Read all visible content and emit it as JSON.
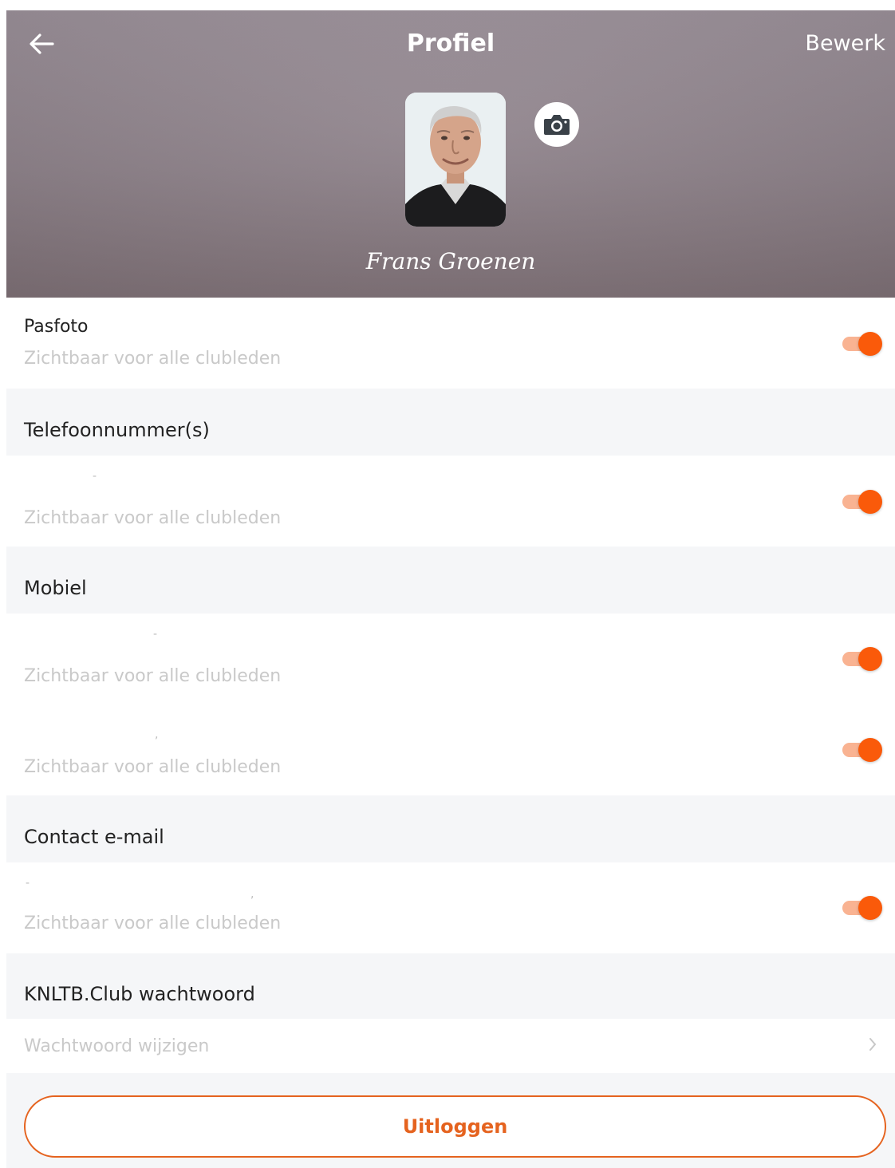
{
  "header": {
    "title": "Profiel",
    "edit_label": "Bewerk",
    "user_name": "Frans Groenen"
  },
  "rows": {
    "pasfoto": {
      "label": "Pasfoto",
      "visibility": "Zichtbaar voor alle clubleden",
      "enabled": true
    },
    "telefoon": {
      "value": "-",
      "visibility": "Zichtbaar voor alle clubleden",
      "enabled": true
    },
    "mobiel1": {
      "value": "-",
      "visibility": "Zichtbaar voor alle clubleden",
      "enabled": true
    },
    "mobiel2": {
      "value": ",",
      "visibility": "Zichtbaar voor alle clubleden",
      "enabled": true
    },
    "email": {
      "value": "-",
      "value2": ",",
      "visibility": "Zichtbaar voor alle clubleden",
      "enabled": true
    },
    "password": {
      "label": "Wachtwoord wijzigen"
    }
  },
  "sections": {
    "telefoon": "Telefoonnummer(s)",
    "mobiel": "Mobiel",
    "email": "Contact e-mail",
    "password": "KNLTB.Club wachtwoord"
  },
  "logout_label": "Uitloggen",
  "colors": {
    "accent": "#fa5a0a",
    "accent_light": "#f9b392",
    "section_bg": "#f5f6f8"
  },
  "icons": {
    "back": "arrow-left-icon",
    "camera": "camera-icon",
    "chevron": "chevron-right-icon"
  }
}
